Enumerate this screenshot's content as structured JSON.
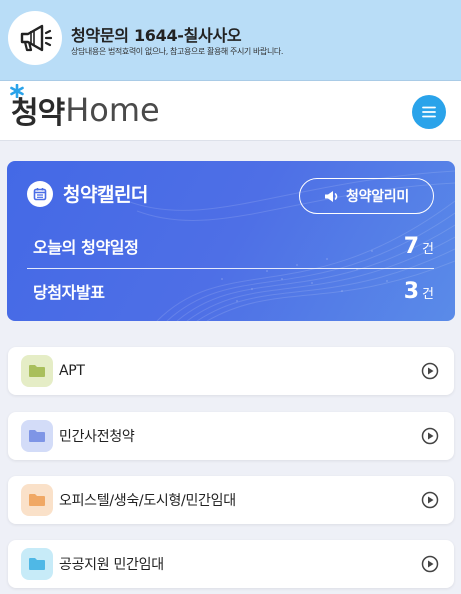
{
  "notice": {
    "title": "청약문의 1644-칠사사오",
    "subtitle": "상담내용은 법적효력이 없으나, 참고용으로 활용해 주시기 바랍니다."
  },
  "header": {
    "logo_korean": "청약",
    "logo_english": "Home",
    "logo_accent_color": "#2aa3ea"
  },
  "calendar": {
    "title": "청약캘린더",
    "alarm_button": "청약알리미",
    "rows": [
      {
        "label": "오늘의 청약일정",
        "count": "7",
        "unit": "건"
      },
      {
        "label": "당첨자발표",
        "count": "3",
        "unit": "건"
      }
    ],
    "color": "#4a6de6"
  },
  "categories": [
    {
      "label": "APT",
      "folder_color": "#c4d97e",
      "icon": "folder-icon"
    },
    {
      "label": "민간사전청약",
      "folder_color": "#9aaef0",
      "icon": "folder-icon"
    },
    {
      "label": "오피스텔/생숙/도시형/민간임대",
      "folder_color": "#f3bf8f",
      "icon": "folder-icon"
    },
    {
      "label": "공공지원 민간임대",
      "folder_color": "#7ccdf0",
      "icon": "folder-icon"
    }
  ]
}
